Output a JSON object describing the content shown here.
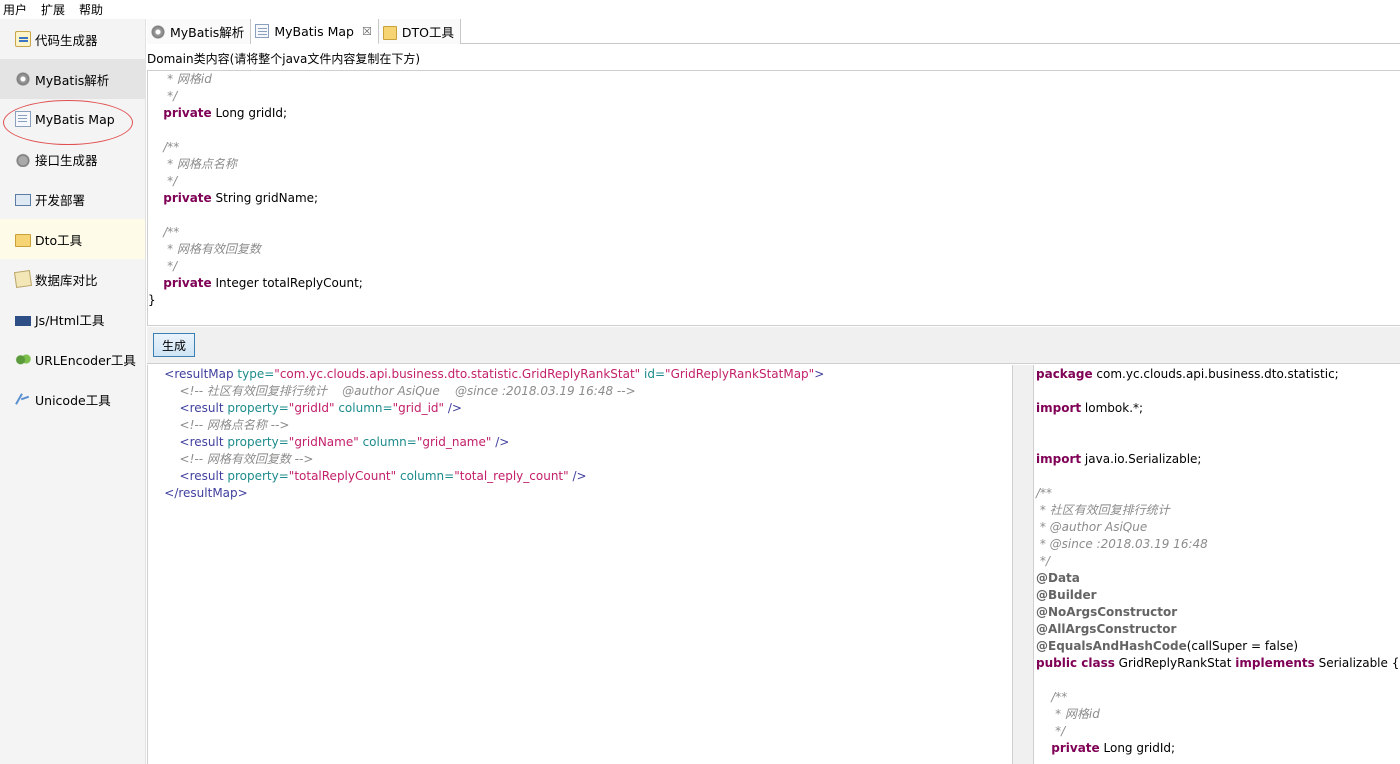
{
  "menu": [
    "用户",
    "扩展",
    "帮助"
  ],
  "sidebar": {
    "items": [
      {
        "label": "代码生成器",
        "icon": "code-generator-icon"
      },
      {
        "label": "MyBatis解析",
        "icon": "gear-icon"
      },
      {
        "label": "MyBatis Map",
        "icon": "document-icon"
      },
      {
        "label": "接口生成器",
        "icon": "interface-gear-icon"
      },
      {
        "label": "开发部署",
        "icon": "computer-icon"
      },
      {
        "label": "Dto工具",
        "icon": "folder-icon"
      },
      {
        "label": "数据库对比",
        "icon": "compare-icon"
      },
      {
        "label": "Js/Html工具",
        "icon": "html-icon"
      },
      {
        "label": "URLEncoder工具",
        "icon": "encoder-icon"
      },
      {
        "label": "Unicode工具",
        "icon": "unicode-icon"
      }
    ],
    "active_index": 1,
    "highlighted_index": 5,
    "circled_index": 2
  },
  "tabs": [
    {
      "label": "MyBatis解析",
      "icon": "gear-icon",
      "active": false,
      "closable": false
    },
    {
      "label": "MyBatis Map",
      "icon": "document-icon",
      "active": true,
      "closable": true
    },
    {
      "label": "DTO工具",
      "icon": "folder-icon",
      "active": false,
      "closable": false
    }
  ],
  "tab_close_glyph": "☒",
  "domain_label": "Domain类内容(请将整个java文件内容复制在下方)",
  "domain_code": [
    [
      [
        "cm",
        "     * 网格id"
      ]
    ],
    [
      [
        "cm",
        "     */"
      ]
    ],
    [
      [
        "",
        "    "
      ],
      [
        "kw",
        "private"
      ],
      [
        "",
        " Long gridId;"
      ]
    ],
    [
      [
        "",
        ""
      ]
    ],
    [
      [
        "cm",
        "    /**"
      ]
    ],
    [
      [
        "cm",
        "     * 网格点名称"
      ]
    ],
    [
      [
        "cm",
        "     */"
      ]
    ],
    [
      [
        "",
        "    "
      ],
      [
        "kw",
        "private"
      ],
      [
        "",
        " String gridName;"
      ]
    ],
    [
      [
        "",
        ""
      ]
    ],
    [
      [
        "cm",
        "    /**"
      ]
    ],
    [
      [
        "cm",
        "     * 网格有效回复数"
      ]
    ],
    [
      [
        "cm",
        "     */"
      ]
    ],
    [
      [
        "",
        "    "
      ],
      [
        "kw",
        "private"
      ],
      [
        "",
        " Integer totalReplyCount;"
      ]
    ],
    [
      [
        "",
        "}"
      ]
    ]
  ],
  "generate_button": "生成",
  "xml_code": [
    [
      [
        "",
        "    "
      ],
      [
        "tag",
        "<resultMap"
      ],
      [
        "",
        " "
      ],
      [
        "attr",
        "type="
      ],
      [
        "val",
        "\"com.yc.clouds.api.business.dto.statistic.GridReplyRankStat\""
      ],
      [
        "",
        " "
      ],
      [
        "attr",
        "id="
      ],
      [
        "val",
        "\"GridReplyRankStatMap\""
      ],
      [
        "tag",
        ">"
      ]
    ],
    [
      [
        "",
        "        "
      ],
      [
        "cm",
        "<!-- 社区有效回复排行统计    @author AsiQue    @since :2018.03.19 16:48 -->"
      ]
    ],
    [
      [
        "",
        "        "
      ],
      [
        "tag",
        "<result"
      ],
      [
        "",
        " "
      ],
      [
        "attr",
        "property="
      ],
      [
        "val",
        "\"gridId\""
      ],
      [
        "",
        " "
      ],
      [
        "attr",
        "column="
      ],
      [
        "val",
        "\"grid_id\""
      ],
      [
        "",
        " "
      ],
      [
        "tag",
        "/>"
      ]
    ],
    [
      [
        "",
        "        "
      ],
      [
        "cm",
        "<!-- 网格点名称 -->"
      ]
    ],
    [
      [
        "",
        "        "
      ],
      [
        "tag",
        "<result"
      ],
      [
        "",
        " "
      ],
      [
        "attr",
        "property="
      ],
      [
        "val",
        "\"gridName\""
      ],
      [
        "",
        " "
      ],
      [
        "attr",
        "column="
      ],
      [
        "val",
        "\"grid_name\""
      ],
      [
        "",
        " "
      ],
      [
        "tag",
        "/>"
      ]
    ],
    [
      [
        "",
        "        "
      ],
      [
        "cm",
        "<!-- 网格有效回复数 -->"
      ]
    ],
    [
      [
        "",
        "        "
      ],
      [
        "tag",
        "<result"
      ],
      [
        "",
        " "
      ],
      [
        "attr",
        "property="
      ],
      [
        "val",
        "\"totalReplyCount\""
      ],
      [
        "",
        " "
      ],
      [
        "attr",
        "column="
      ],
      [
        "val",
        "\"total_reply_count\""
      ],
      [
        "",
        " "
      ],
      [
        "tag",
        "/>"
      ]
    ],
    [
      [
        "",
        "    "
      ],
      [
        "tag",
        "</resultMap>"
      ]
    ]
  ],
  "java_code": [
    [
      [
        "kw",
        "package"
      ],
      [
        "",
        " com.yc.clouds.api.business.dto.statistic;"
      ]
    ],
    [
      [
        "",
        ""
      ]
    ],
    [
      [
        "kw",
        "import"
      ],
      [
        "",
        " lombok.*;"
      ]
    ],
    [
      [
        "",
        ""
      ]
    ],
    [
      [
        "",
        ""
      ]
    ],
    [
      [
        "kw",
        "import"
      ],
      [
        "",
        " java.io.Serializable;"
      ]
    ],
    [
      [
        "",
        ""
      ]
    ],
    [
      [
        "cm",
        "/**"
      ]
    ],
    [
      [
        "cm",
        " * 社区有效回复排行统计"
      ]
    ],
    [
      [
        "cm",
        " * @author AsiQue"
      ]
    ],
    [
      [
        "cm",
        " * @since :2018.03.19 16:48"
      ]
    ],
    [
      [
        "cm",
        " */"
      ]
    ],
    [
      [
        "an",
        "@Data"
      ]
    ],
    [
      [
        "an",
        "@Builder"
      ]
    ],
    [
      [
        "an",
        "@NoArgsConstructor"
      ]
    ],
    [
      [
        "an",
        "@AllArgsConstructor"
      ]
    ],
    [
      [
        "an",
        "@EqualsAndHashCode"
      ],
      [
        "",
        "(callSuper = false)"
      ]
    ],
    [
      [
        "kw",
        "public class"
      ],
      [
        "",
        " GridReplyRankStat "
      ],
      [
        "kw",
        "implements"
      ],
      [
        "",
        " Serializable {"
      ]
    ],
    [
      [
        "",
        ""
      ]
    ],
    [
      [
        "cm",
        "    /**"
      ]
    ],
    [
      [
        "cm",
        "     * 网格id"
      ]
    ],
    [
      [
        "cm",
        "     */"
      ]
    ],
    [
      [
        "",
        "    "
      ],
      [
        "kw",
        "private"
      ],
      [
        "",
        " Long gridId;"
      ]
    ]
  ]
}
